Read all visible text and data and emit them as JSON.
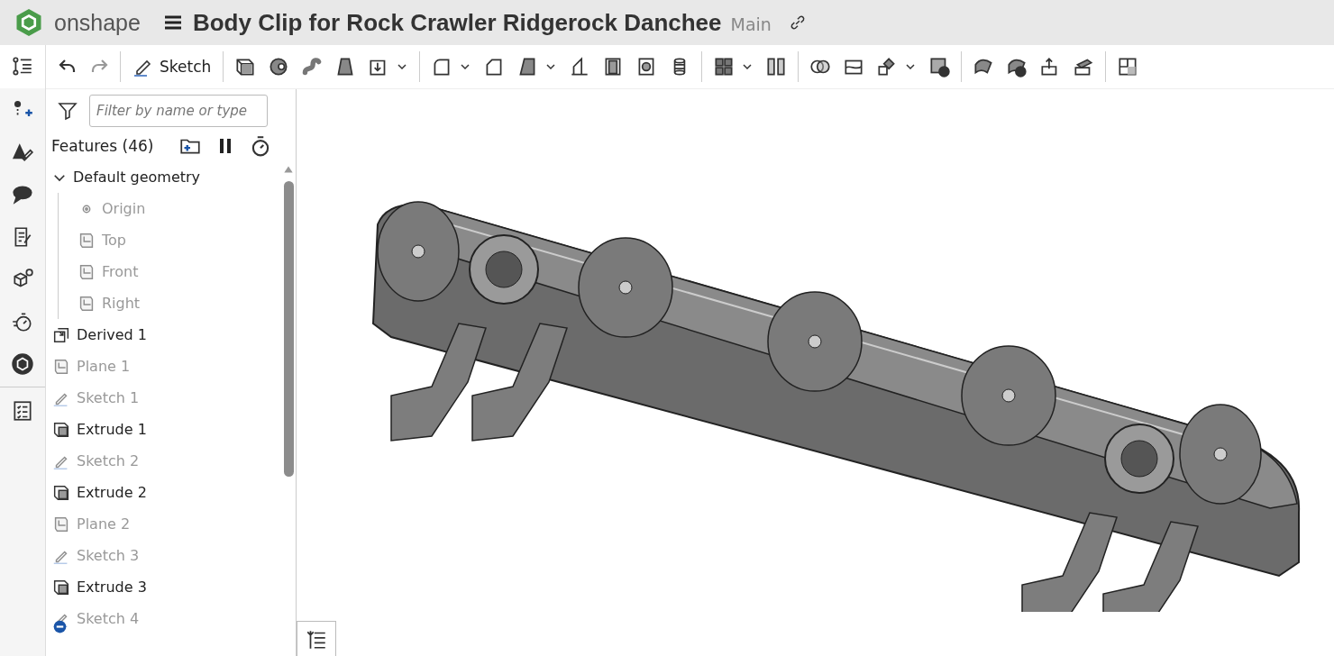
{
  "header": {
    "brand": "onshape",
    "title": "Body Clip for Rock Crawler Ridgerock Danchee",
    "branch": "Main"
  },
  "toolbar": {
    "sketch_label": "Sketch"
  },
  "filter": {
    "placeholder": "Filter by name or type"
  },
  "features": {
    "heading": "Features (46)",
    "items": [
      {
        "label": "Default geometry",
        "kind": "group",
        "dimmed": false,
        "flagged": false,
        "expanded": true,
        "children": [
          {
            "label": "Origin",
            "kind": "origin",
            "dimmed": true,
            "flagged": false
          },
          {
            "label": "Top",
            "kind": "plane",
            "dimmed": true,
            "flagged": false
          },
          {
            "label": "Front",
            "kind": "plane",
            "dimmed": true,
            "flagged": false
          },
          {
            "label": "Right",
            "kind": "plane",
            "dimmed": true,
            "flagged": false
          }
        ]
      },
      {
        "label": "Derived 1",
        "kind": "derived",
        "dimmed": false,
        "flagged": false
      },
      {
        "label": "Plane 1",
        "kind": "plane",
        "dimmed": true,
        "flagged": false
      },
      {
        "label": "Sketch 1",
        "kind": "sketch",
        "dimmed": true,
        "flagged": false
      },
      {
        "label": "Extrude 1",
        "kind": "extrude",
        "dimmed": false,
        "flagged": false
      },
      {
        "label": "Sketch 2",
        "kind": "sketch",
        "dimmed": true,
        "flagged": false
      },
      {
        "label": "Extrude 2",
        "kind": "extrude",
        "dimmed": false,
        "flagged": false
      },
      {
        "label": "Plane 2",
        "kind": "plane",
        "dimmed": true,
        "flagged": false
      },
      {
        "label": "Sketch 3",
        "kind": "sketch",
        "dimmed": true,
        "flagged": false
      },
      {
        "label": "Extrude 3",
        "kind": "extrude",
        "dimmed": false,
        "flagged": false
      },
      {
        "label": "Sketch 4",
        "kind": "sketch",
        "dimmed": true,
        "flagged": true
      }
    ]
  }
}
